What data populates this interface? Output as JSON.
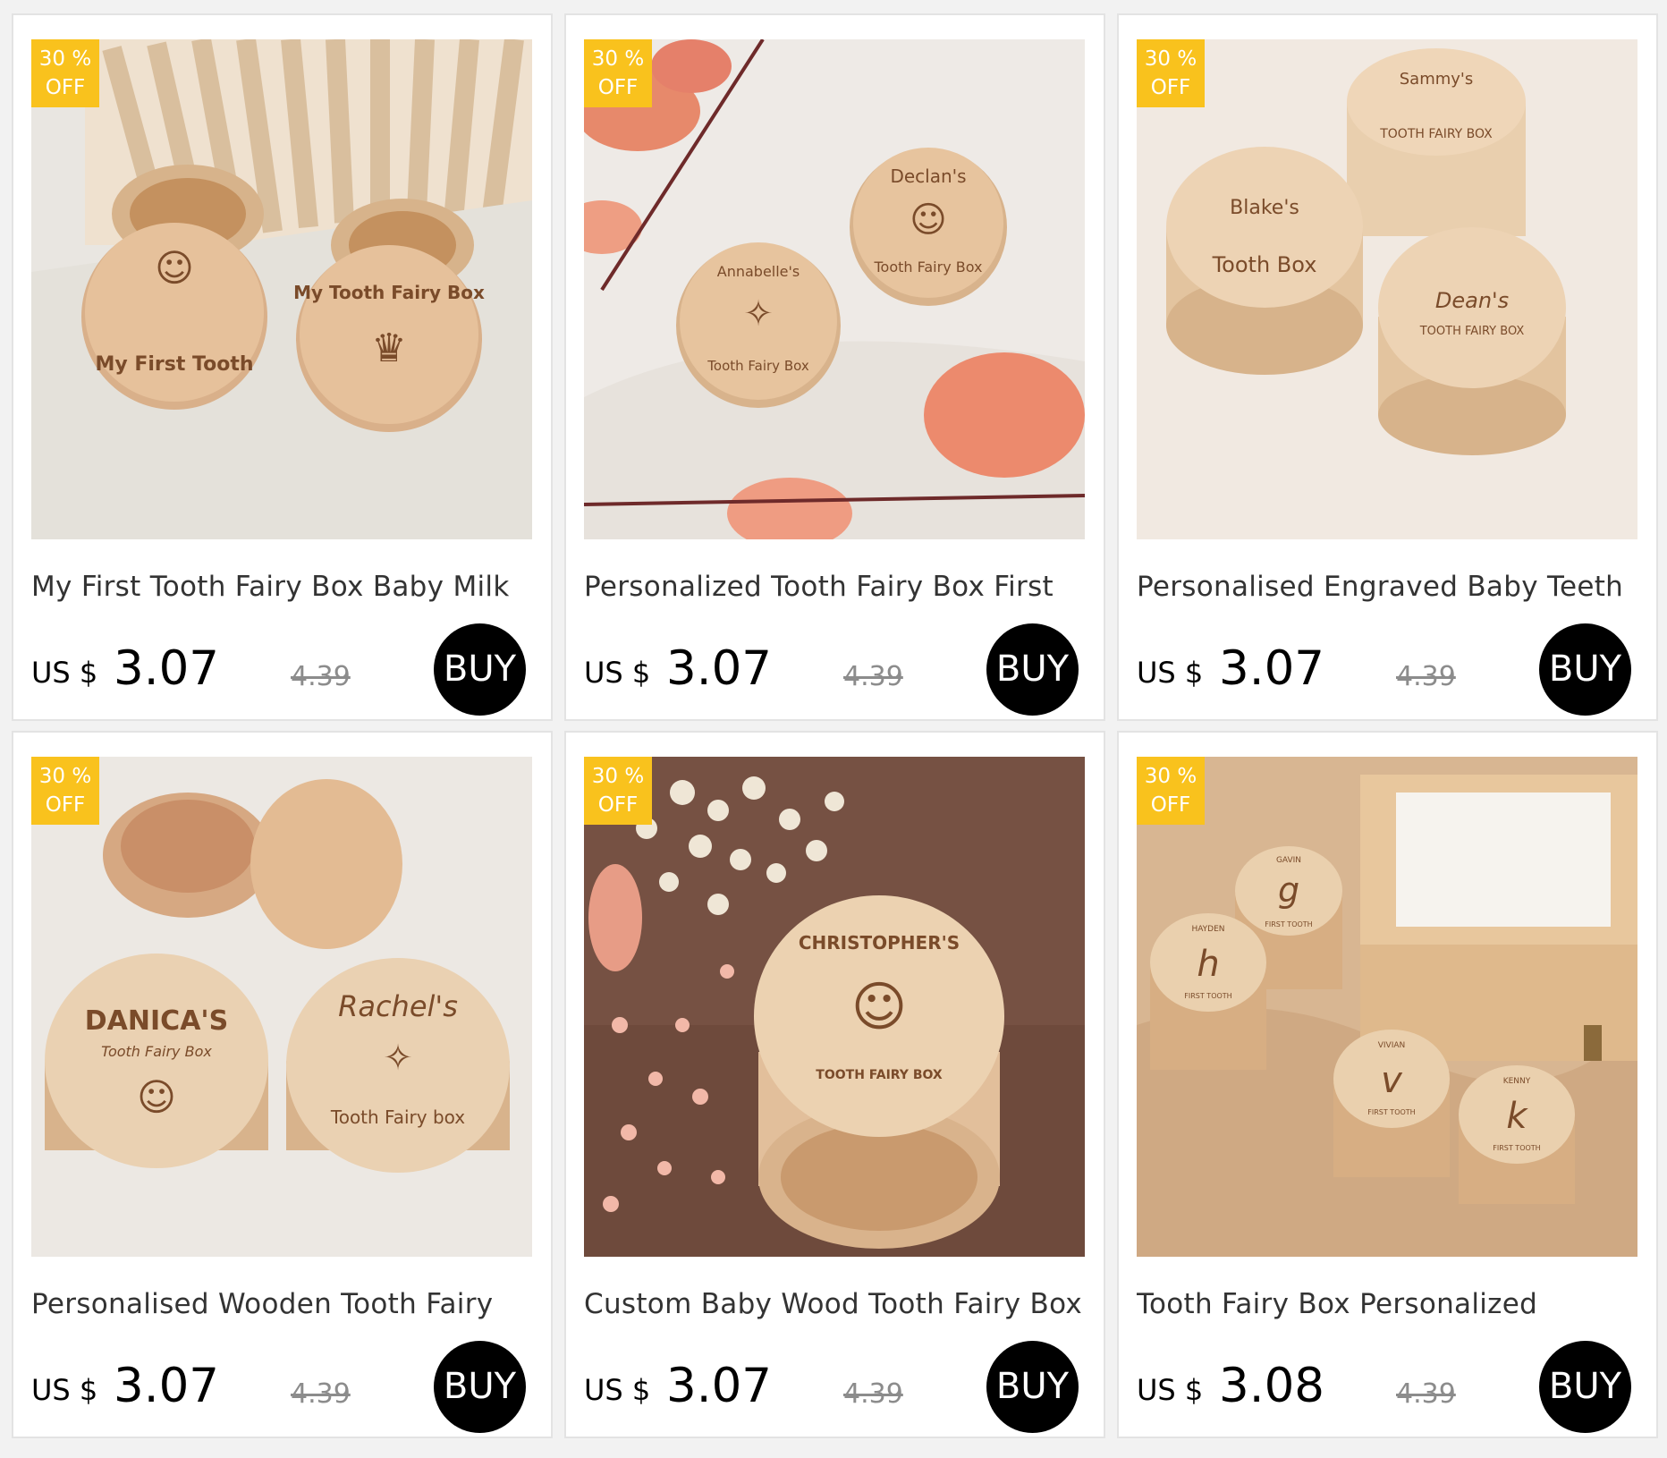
{
  "badge": {
    "line1": "30 %",
    "line2": "OFF",
    "color": "#f9c21d"
  },
  "currency": "US $",
  "buy_label": "BUY",
  "products": [
    {
      "title": "My First Tooth Fairy Box Baby Milk",
      "price": "3.07",
      "original_price": "4.39",
      "engravings": [
        "My First Tooth",
        "My Tooth Fairy Box"
      ]
    },
    {
      "title": "Personalized Tooth Fairy Box First",
      "price": "3.07",
      "original_price": "4.39",
      "engravings": [
        "Annabelle's",
        "Tooth Fairy Box",
        "Declan's",
        "Tooth Fairy Box"
      ]
    },
    {
      "title": "Personalised Engraved Baby Teeth",
      "price": "3.07",
      "original_price": "4.39",
      "engravings": [
        "Blake's",
        "Tooth Box",
        "Sammy's",
        "TOOTH FAIRY BOX",
        "Dean's",
        "TOOTH FAIRY BOX"
      ]
    },
    {
      "title": "Personalised Wooden Tooth Fairy",
      "price": "3.07",
      "original_price": "4.39",
      "engravings": [
        "DANICA'S",
        "Tooth Fairy Box",
        "Rachel's",
        "Tooth Fairy box"
      ]
    },
    {
      "title": "Custom Baby Wood Tooth Fairy Box",
      "price": "3.07",
      "original_price": "4.39",
      "engravings": [
        "CHRISTOPHER'S",
        "TOOTH FAIRY BOX"
      ]
    },
    {
      "title": "Tooth Fairy Box Personalized",
      "price": "3.08",
      "original_price": "4.39",
      "engravings": [
        "h",
        "HAYDEN",
        "FIRST TOOTH",
        "g",
        "GAVIN",
        "FIRST TOOTH",
        "v",
        "VIVIAN",
        "FIRST TOOTH",
        "k",
        "KENNY",
        "FIRST TOOTH"
      ]
    }
  ]
}
